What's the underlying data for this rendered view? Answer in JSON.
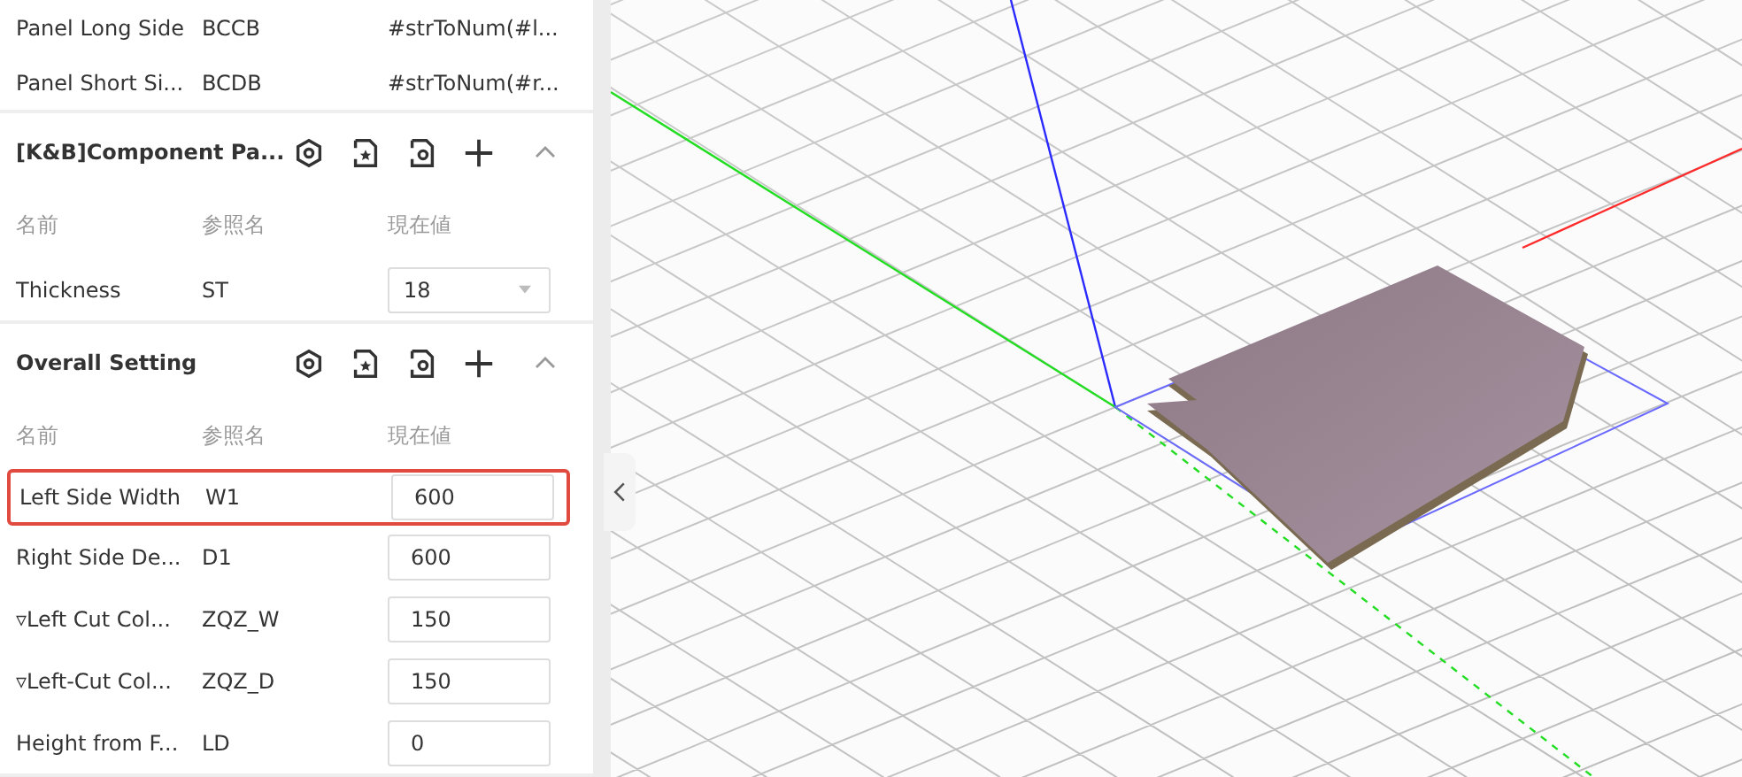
{
  "top_rows": [
    {
      "name": "Panel Long Side",
      "ref": "BCCB",
      "value": "#strToNum(#l..."
    },
    {
      "name": "Panel Short Si...",
      "ref": "BCDB",
      "value": "#strToNum(#r..."
    }
  ],
  "sections": [
    {
      "title": "[K&B]Component Pa...",
      "expanded": true,
      "columns": [
        "名前",
        "参照名",
        "現在値"
      ],
      "rows": [
        {
          "kind": "select",
          "name": "Thickness",
          "ref": "ST",
          "value": "18",
          "highlighted": false
        }
      ]
    },
    {
      "title": "Overall Setting",
      "expanded": true,
      "columns": [
        "名前",
        "参照名",
        "現在値"
      ],
      "rows": [
        {
          "kind": "input",
          "name": "Left Side Width",
          "ref": "W1",
          "value": "600",
          "highlighted": true
        },
        {
          "kind": "input",
          "name": "Right Side De...",
          "ref": "D1",
          "value": "600",
          "highlighted": false
        },
        {
          "kind": "input",
          "name": "▿Left Cut Col...",
          "ref": "ZQZ_W",
          "value": "150",
          "highlighted": false
        },
        {
          "kind": "input",
          "name": "▿Left-Cut Col...",
          "ref": "ZQZ_D",
          "value": "150",
          "highlighted": false
        },
        {
          "kind": "input",
          "name": "Height from F...",
          "ref": "LD",
          "value": "0",
          "highlighted": false
        }
      ]
    }
  ]
}
